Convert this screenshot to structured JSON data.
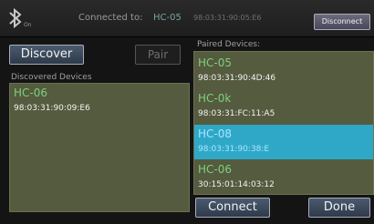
{
  "header": {
    "icon": "bluetooth-icon",
    "icon_caption": "On",
    "connected_label": "Connected to:",
    "connected_device": "HC-05",
    "connected_mac": "98:03:31:90:05:E6",
    "disconnect_label": "Disconnect"
  },
  "discover_panel": {
    "discover_label": "Discover",
    "pair_label": "Pair",
    "section_label": "Discovered Devices",
    "devices": [
      {
        "name": "HC-06",
        "mac": "98:03:31:90:09:E6"
      }
    ]
  },
  "paired_panel": {
    "section_label": "Paired Devices:",
    "devices": [
      {
        "name": "HC-05",
        "mac": "98:03:31:90:4D:46"
      },
      {
        "name": "HC-0k",
        "mac": "98:03:31:FC:11:A5"
      },
      {
        "name": "HC-08",
        "mac": "98:03:31:90:38:E"
      },
      {
        "name": "HC-06",
        "mac": "30:15:01:14:03:12"
      }
    ],
    "selected_index": 2,
    "connect_label": "Connect",
    "done_label": "Done"
  },
  "colors": {
    "list_background": "#555b3e",
    "device_name": "#7dd07d",
    "selection": "#2fa8c8"
  }
}
